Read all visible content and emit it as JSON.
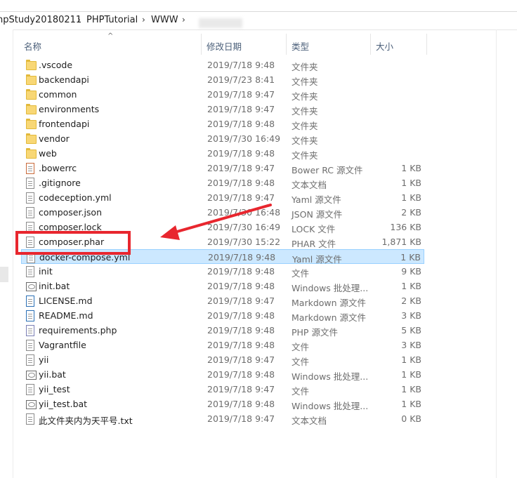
{
  "breadcrumb": {
    "items": [
      "npStudy20180211",
      "PHPTutorial",
      "WWW"
    ],
    "separator": "›"
  },
  "columns": {
    "name": "名称",
    "date": "修改日期",
    "type": "类型",
    "size": "大小"
  },
  "files": [
    {
      "name": ".vscode",
      "date": "2019/7/18 9:48",
      "type": "文件夹",
      "size": "",
      "icon": "folder-icon"
    },
    {
      "name": "backendapi",
      "date": "2019/7/23 8:41",
      "type": "文件夹",
      "size": "",
      "icon": "folder-icon"
    },
    {
      "name": "common",
      "date": "2019/7/18 9:47",
      "type": "文件夹",
      "size": "",
      "icon": "folder-icon"
    },
    {
      "name": "environments",
      "date": "2019/7/18 9:47",
      "type": "文件夹",
      "size": "",
      "icon": "folder-icon"
    },
    {
      "name": "frontendapi",
      "date": "2019/7/18 9:48",
      "type": "文件夹",
      "size": "",
      "icon": "folder-icon"
    },
    {
      "name": "vendor",
      "date": "2019/7/30 16:49",
      "type": "文件夹",
      "size": "",
      "icon": "folder-icon"
    },
    {
      "name": "web",
      "date": "2019/7/18 9:48",
      "type": "文件夹",
      "size": "",
      "icon": "folder-icon"
    },
    {
      "name": ".bowerrc",
      "date": "2019/7/18 9:47",
      "type": "Bower RC 源文件",
      "size": "1 KB",
      "icon": "bower-file-icon"
    },
    {
      "name": ".gitignore",
      "date": "2019/7/18 9:48",
      "type": "文本文档",
      "size": "1 KB",
      "icon": "text-file-icon"
    },
    {
      "name": "codeception.yml",
      "date": "2019/7/18 9:47",
      "type": "Yaml 源文件",
      "size": "1 KB",
      "icon": "yaml-file-icon"
    },
    {
      "name": "composer.json",
      "date": "2019/7/30 16:48",
      "type": "JSON 源文件",
      "size": "2 KB",
      "icon": "json-file-icon"
    },
    {
      "name": "composer.lock",
      "date": "2019/7/30 16:49",
      "type": "LOCK 文件",
      "size": "136 KB",
      "icon": "file-icon"
    },
    {
      "name": "composer.phar",
      "date": "2019/7/30 15:22",
      "type": "PHAR 文件",
      "size": "1,871 KB",
      "icon": "file-icon"
    },
    {
      "name": "docker-compose.yml",
      "date": "2019/7/18 9:48",
      "type": "Yaml 源文件",
      "size": "1 KB",
      "icon": "yaml-file-icon"
    },
    {
      "name": "init",
      "date": "2019/7/18 9:48",
      "type": "文件",
      "size": "9 KB",
      "icon": "file-icon"
    },
    {
      "name": "init.bat",
      "date": "2019/7/18 9:48",
      "type": "Windows 批处理...",
      "size": "1 KB",
      "icon": "batch-file-icon"
    },
    {
      "name": "LICENSE.md",
      "date": "2019/7/18 9:47",
      "type": "Markdown 源文件",
      "size": "2 KB",
      "icon": "markdown-file-icon"
    },
    {
      "name": "README.md",
      "date": "2019/7/18 9:48",
      "type": "Markdown 源文件",
      "size": "3 KB",
      "icon": "markdown-file-icon"
    },
    {
      "name": "requirements.php",
      "date": "2019/7/18 9:48",
      "type": "PHP 源文件",
      "size": "5 KB",
      "icon": "php-file-icon"
    },
    {
      "name": "Vagrantfile",
      "date": "2019/7/18 9:48",
      "type": "文件",
      "size": "3 KB",
      "icon": "file-icon"
    },
    {
      "name": "yii",
      "date": "2019/7/18 9:47",
      "type": "文件",
      "size": "1 KB",
      "icon": "file-icon"
    },
    {
      "name": "yii.bat",
      "date": "2019/7/18 9:48",
      "type": "Windows 批处理...",
      "size": "1 KB",
      "icon": "batch-file-icon"
    },
    {
      "name": "yii_test",
      "date": "2019/7/18 9:47",
      "type": "文件",
      "size": "1 KB",
      "icon": "file-icon"
    },
    {
      "name": "yii_test.bat",
      "date": "2019/7/18 9:48",
      "type": "Windows 批处理...",
      "size": "1 KB",
      "icon": "batch-file-icon"
    },
    {
      "name": "此文件夹内为天平号.txt",
      "date": "2019/7/18 9:47",
      "type": "文本文档",
      "size": "0 KB",
      "icon": "text-file-icon"
    }
  ],
  "selected_file": "docker-compose.yml",
  "annotation": {
    "highlighted_file": "composer.phar",
    "color": "#e8262e"
  },
  "colors": {
    "selection": "#cce8ff",
    "folder": "#f8d775",
    "header_text": "#4c607a"
  }
}
